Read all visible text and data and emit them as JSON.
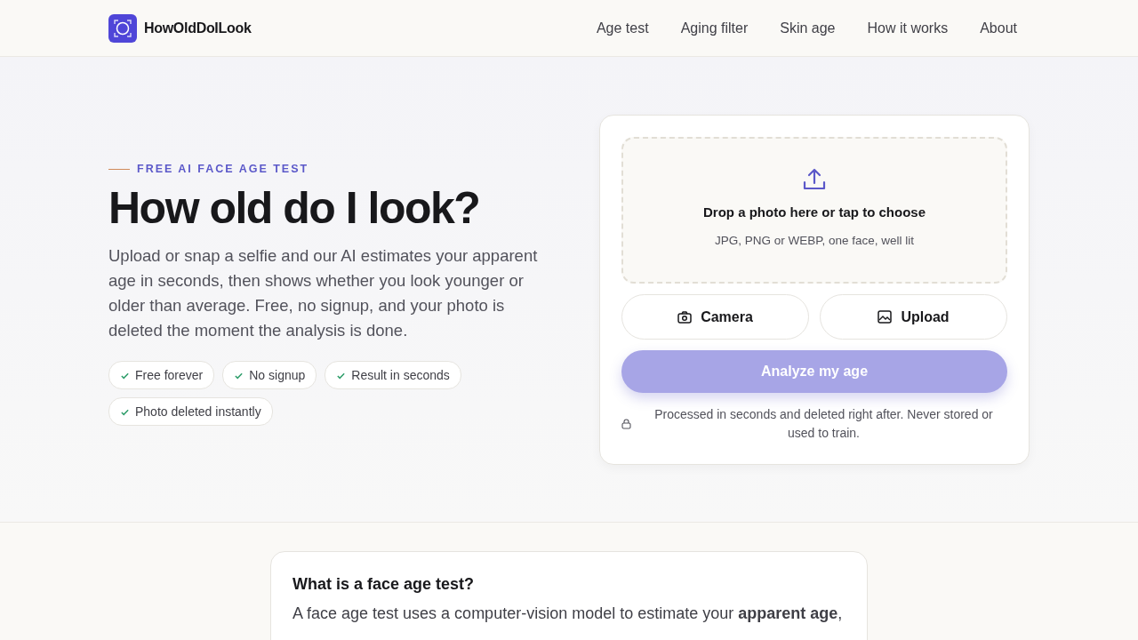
{
  "brand": {
    "name": "HowOldDoILook"
  },
  "nav": [
    "Age test",
    "Aging filter",
    "Skin age",
    "How it works",
    "About"
  ],
  "hero": {
    "eyebrow": "FREE AI FACE AGE TEST",
    "title": "How old do I look?",
    "lead": "Upload or snap a selfie and our AI estimates your apparent age in seconds, then shows whether you look younger or older than average. Free, no signup, and your photo is deleted the moment the analysis is done.",
    "badges": [
      "Free forever",
      "No signup",
      "Result in seconds",
      "Photo deleted instantly"
    ]
  },
  "uploader": {
    "drop_title": "Drop a photo here or tap to choose",
    "drop_hint": "JPG, PNG or WEBP, one face, well lit",
    "buttons": [
      {
        "kind": "camera",
        "label": "Camera"
      },
      {
        "kind": "upload",
        "label": "Upload"
      }
    ],
    "submit": {
      "label": "Analyze my age",
      "disabled": true
    },
    "privacy_note": "Processed in seconds and deleted right after. Never stored or used to train."
  },
  "faq": {
    "title": "What is a face age test?",
    "text": "A face age test uses a computer-vision model to estimate your **apparent age**,"
  }
}
